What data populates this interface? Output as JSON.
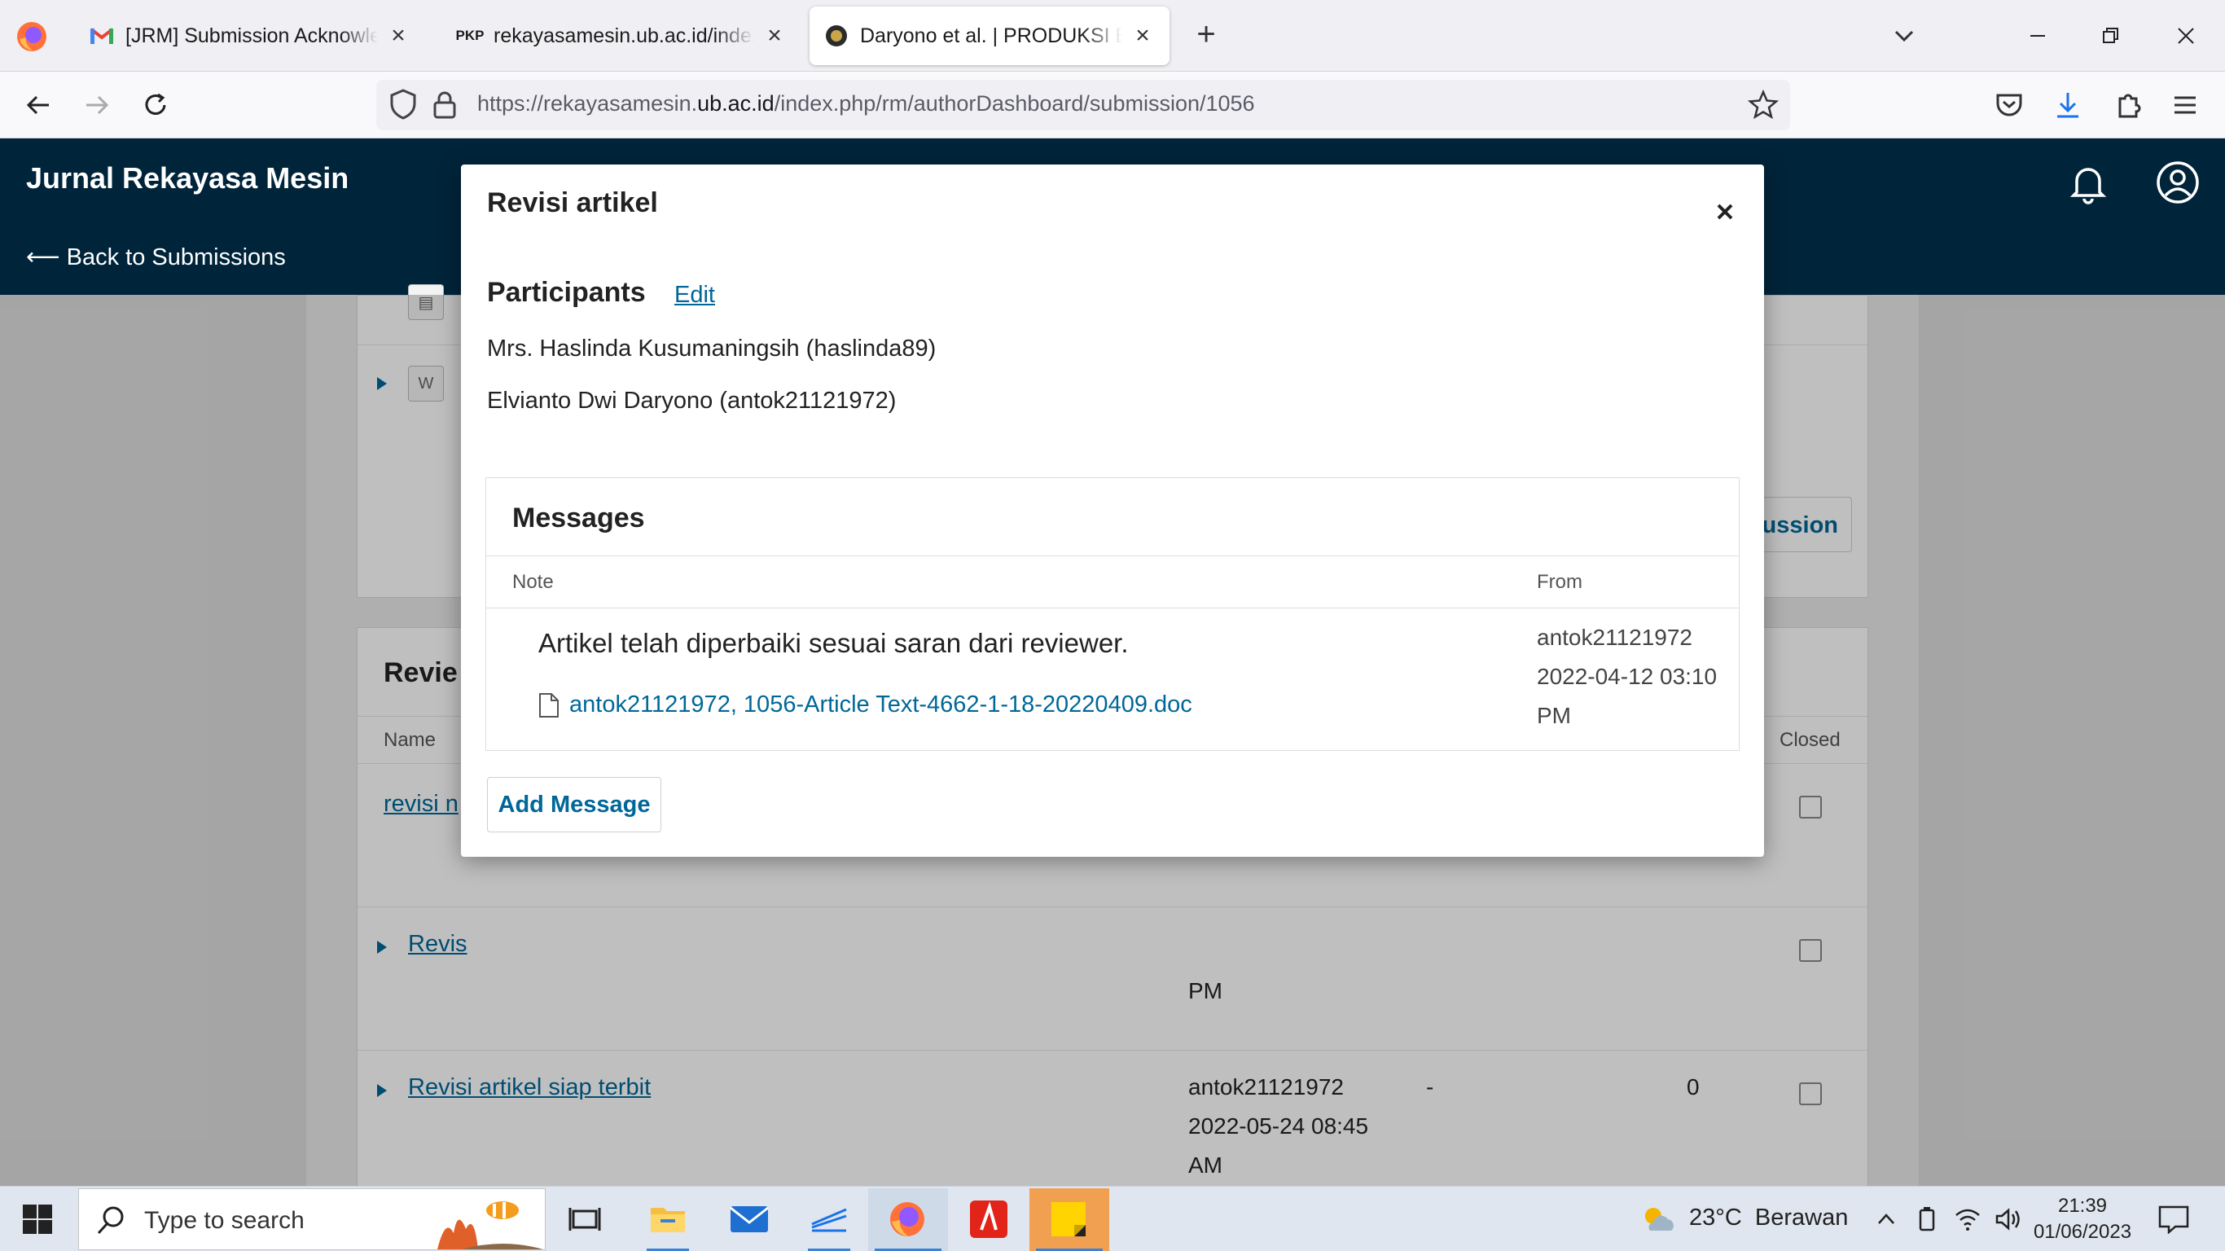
{
  "browser": {
    "tabs": [
      {
        "title": "[JRM] Submission Acknowledgement",
        "favicon": "gmail-icon",
        "active": false
      },
      {
        "title": "rekayasamesin.ub.ac.id/index.php/rm/authorDashboard",
        "favicon_text": "PKP",
        "active": false
      },
      {
        "title": "Daryono et al. | PRODUKSI BIODIESEL",
        "favicon": "journal-icon",
        "active": true
      }
    ],
    "url_prefix": "https://rekayasamesin.",
    "url_domain": "ub.ac.id",
    "url_path": "/index.php/rm/authorDashboard/submission/1056"
  },
  "app": {
    "journal_title": "Jurnal Rekayasa Mesin",
    "back_link": "⟵ Back to Submissions"
  },
  "background_page": {
    "reviewer_section_title_partial": "Revie",
    "discussion_button_partial": "cussion",
    "columns": {
      "name": "Name",
      "closed": "Closed"
    },
    "rows": [
      {
        "name_partial": "revisi n"
      },
      {
        "name_partial": "Revis",
        "time_tail": "PM"
      },
      {
        "name": "Revisi artikel siap terbit",
        "from_user": "antok21121972",
        "from_date": "2022-05-24 08:45",
        "from_ampm": "AM",
        "last_reply": "-",
        "replies": "0"
      }
    ]
  },
  "modal": {
    "title": "Revisi artikel",
    "participants_title": "Participants",
    "edit_label": "Edit",
    "participants": [
      "Mrs. Haslinda Kusumaningsih (haslinda89)",
      "Elvianto Dwi Daryono (antok21121972)"
    ],
    "messages_title": "Messages",
    "col_note": "Note",
    "col_from": "From",
    "message": {
      "note": "Artikel telah diperbaiki sesuai saran dari reviewer.",
      "file": "antok21121972, 1056-Article Text-4662-1-18-20220409.doc",
      "from_user": "antok21121972",
      "from_date": "2022-04-12 03:10",
      "from_ampm": "PM"
    },
    "add_message_label": "Add Message"
  },
  "taskbar": {
    "search_placeholder": "Type to search",
    "weather_temp": "23°C",
    "weather_desc": "Berawan",
    "time": "21:39",
    "date": "01/06/2023"
  },
  "colors": {
    "header_bg": "#00243a",
    "link": "#006798",
    "taskbar_bg": "#dfe6ef"
  }
}
